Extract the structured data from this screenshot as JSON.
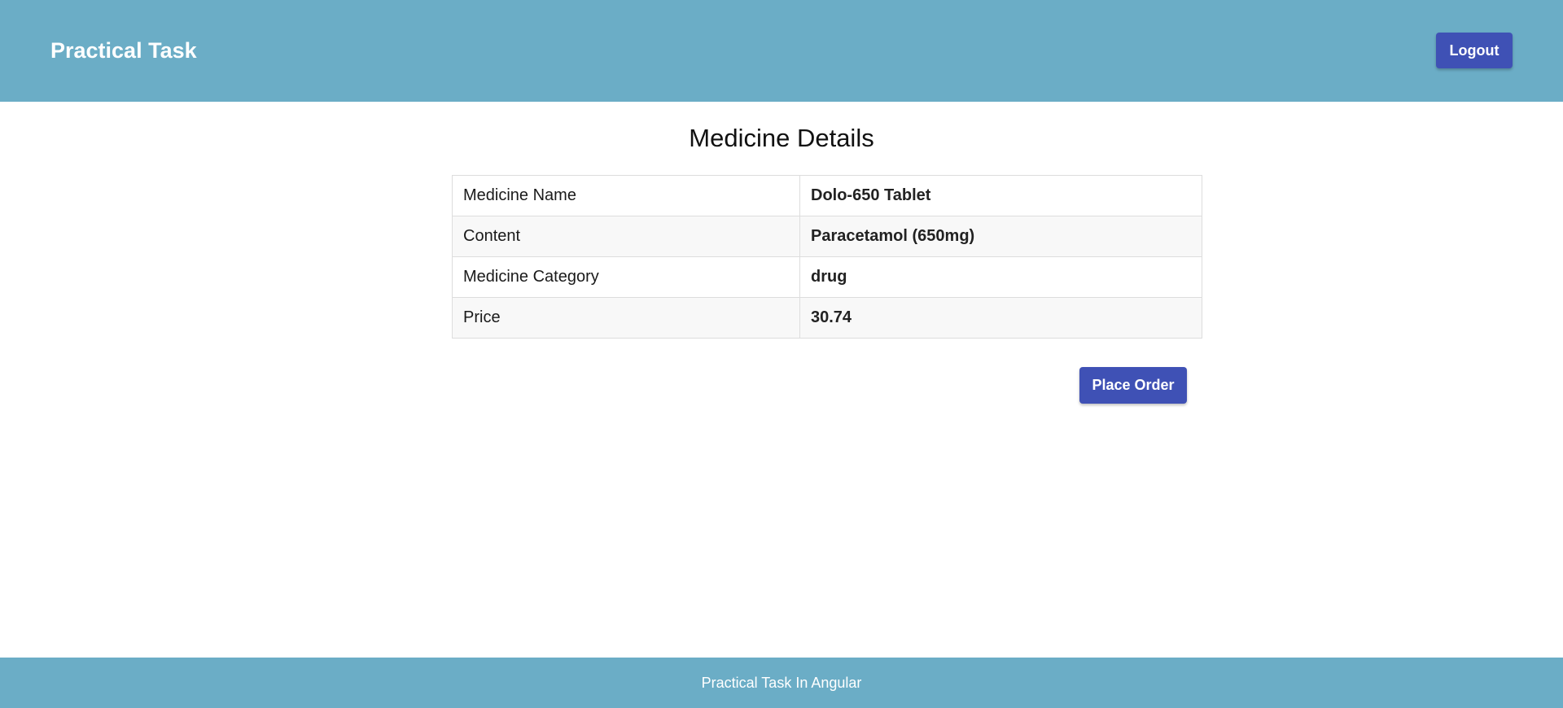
{
  "header": {
    "title": "Practical Task",
    "logout_label": "Logout"
  },
  "main": {
    "title": "Medicine Details",
    "rows": [
      {
        "label": "Medicine Name",
        "value": "Dolo-650 Tablet"
      },
      {
        "label": "Content",
        "value": "Paracetamol (650mg)"
      },
      {
        "label": "Medicine Category",
        "value": "drug"
      },
      {
        "label": "Price",
        "value": "30.74"
      }
    ],
    "place_order_label": "Place Order"
  },
  "footer": {
    "text": "Practical Task In Angular"
  },
  "colors": {
    "header_bg": "#6badc6",
    "button_bg": "#3f51b5"
  }
}
